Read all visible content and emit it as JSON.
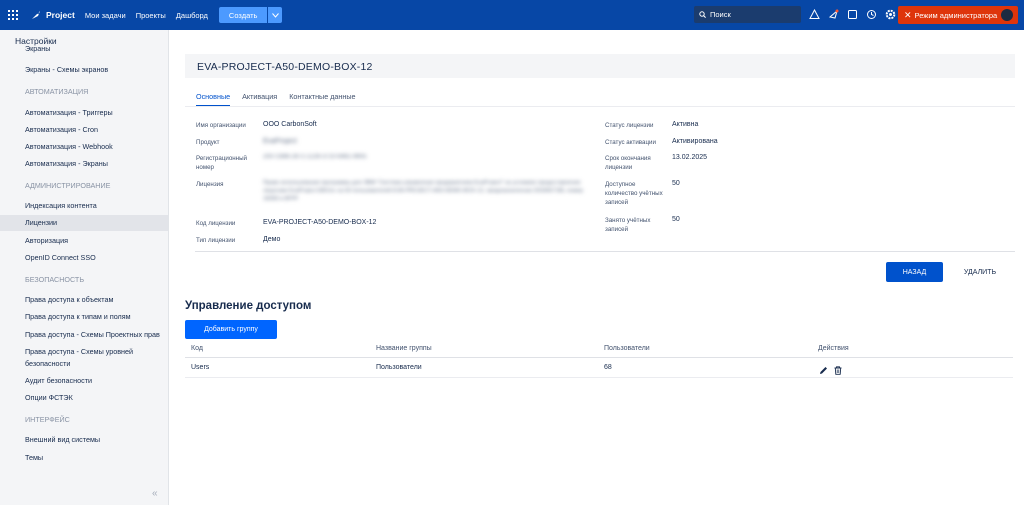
{
  "topbar": {
    "brand": "Project",
    "nav": [
      "Мои задачи",
      "Проекты",
      "Дашборд"
    ],
    "create_label": "Создать",
    "search_placeholder": "Поиск",
    "admin_label": "Режим администратора",
    "icons": [
      "alerts-icon",
      "notifications-icon",
      "feedback-icon",
      "history-icon",
      "settings-icon"
    ]
  },
  "sidebar": {
    "title": "Настройки",
    "items_top": [
      "Экраны",
      "Экраны - Схемы экранов"
    ],
    "section_automation": "АВТОМАТИЗАЦИЯ",
    "automation": [
      "Автоматизация - Триггеры",
      "Автоматизация - Cron",
      "Автоматизация - Webhook",
      "Автоматизация - Экраны"
    ],
    "section_admin": "АДМИНИСТРИРОВАНИЕ",
    "admin": [
      "Индексация контента",
      "Лицензии",
      "Авторизация",
      "OpenID Connect SSO"
    ],
    "section_security": "БЕЗОПАСНОСТЬ",
    "security": [
      "Права доступа к объектам",
      "Права доступа к типам и полям",
      "Права доступа - Схемы Проектных прав",
      "Права доступа - Схемы уровней безопасности",
      "Аудит безопасности",
      "Опции ФСТЭК"
    ],
    "section_interface": "ИНТЕРФЕЙС",
    "interface": [
      "Внешний вид системы",
      "Темы"
    ],
    "active": "Лицензии"
  },
  "license": {
    "title": "EVA-PROJECT-A50-DEMO-BOX-12",
    "tabs": [
      "Основные",
      "Активация",
      "Контактные данные"
    ],
    "left_fields": [
      {
        "label": "Имя организации",
        "value": "ООО CarbonSoft"
      },
      {
        "label": "Продукт",
        "value": "EvaProject"
      },
      {
        "label": "Регистрационный номер",
        "value": "20071986-2671-1226-3710-6461-9905"
      },
      {
        "label": "Лицензия",
        "value": "Право использования программы для ЭВМ \"Система управления предприятием EvaProject\" на условиях предоставления лицензии EvaProject EBOлс на 50 пользователей EVA-PROJECT-A50-DEMO-BOX-12, предназначенная 20336671ВL номер 18283 и 8FPF"
      },
      {
        "label": "Код лицензии",
        "value": "EVA-PROJECT-A50-DEMO-BOX-12"
      },
      {
        "label": "Тип лицензии",
        "value": "Демо"
      }
    ],
    "right_fields": [
      {
        "label": "Статус лицензии",
        "value": "Активна"
      },
      {
        "label": "Статус активации",
        "value": "Активирована"
      },
      {
        "label": "Срок окончания лицензии",
        "value": "13.02.2025"
      },
      {
        "label": "Доступное количество учётных записей",
        "value": "50"
      },
      {
        "label": "Занято учётных записей",
        "value": "50"
      }
    ],
    "save_label": "НАЗАД",
    "delete_label": "УДАЛИТЬ"
  },
  "access": {
    "title": "Управление доступом",
    "add_label": "Добавить группу",
    "columns": [
      "Код",
      "Название группы",
      "Пользователи",
      "Действия"
    ],
    "rows": [
      {
        "code": "Users",
        "name": "Пользователи",
        "users": "68"
      }
    ]
  },
  "colors": {
    "topbar": "#0747a6",
    "admin": "#de350b",
    "primary": "#0052cc"
  }
}
